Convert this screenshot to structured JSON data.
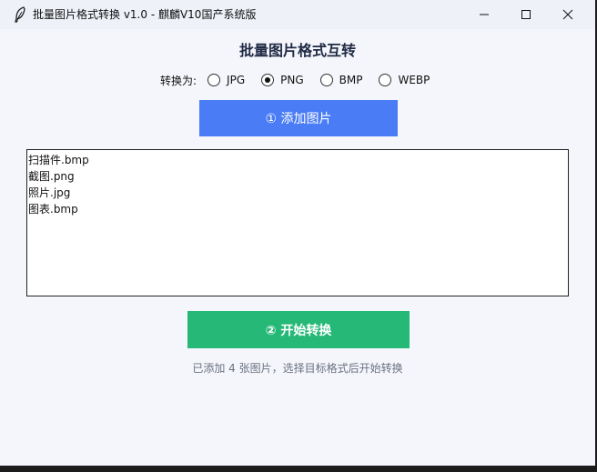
{
  "window": {
    "title": "批量图片格式转换  v1.0  -  麒麟V10国产系统版"
  },
  "main": {
    "heading": "批量图片格式互转",
    "format_label": "转换为:",
    "formats": [
      {
        "label": "JPG",
        "checked": false
      },
      {
        "label": "PNG",
        "checked": true
      },
      {
        "label": "BMP",
        "checked": false
      },
      {
        "label": "WEBP",
        "checked": false
      }
    ],
    "add_button": "①  添加图片",
    "files": [
      "扫描件.bmp",
      "截图.png",
      "照片.jpg",
      "图表.bmp"
    ],
    "start_button": "②  开始转换",
    "status": "已添加 4 张图片，选择目标格式后开始转换"
  }
}
